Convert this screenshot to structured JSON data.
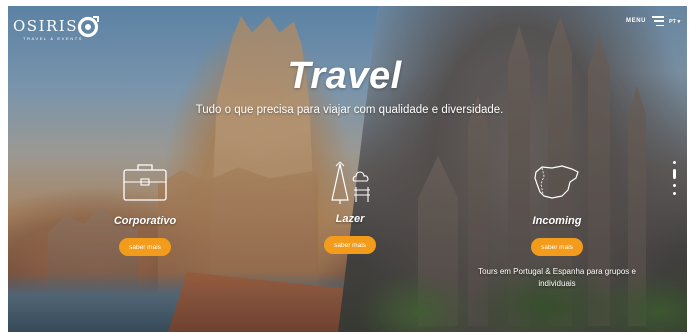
{
  "header": {
    "logo_text": "OSIRIS",
    "logo_tagline": "TRAVEL & EVENTS",
    "menu_label": "MENU",
    "language": "PT"
  },
  "hero": {
    "title": "Travel",
    "subtitle": "Tudo o que precisa para viajar com qualidade e diversidade."
  },
  "cards": [
    {
      "title": "Corporativo",
      "button": "saber mais",
      "icon": "briefcase-icon",
      "description": ""
    },
    {
      "title": "Lazer",
      "button": "saber mais",
      "icon": "leisure-icon",
      "description": ""
    },
    {
      "title": "Incoming",
      "button": "saber mais",
      "icon": "iberia-map-icon",
      "description": "Tours em Portugal & Espanha para grupos e individuais"
    }
  ],
  "pagination": {
    "total": 4,
    "active": 2
  },
  "colors": {
    "accent": "#f39b1b",
    "text": "#ffffff"
  }
}
